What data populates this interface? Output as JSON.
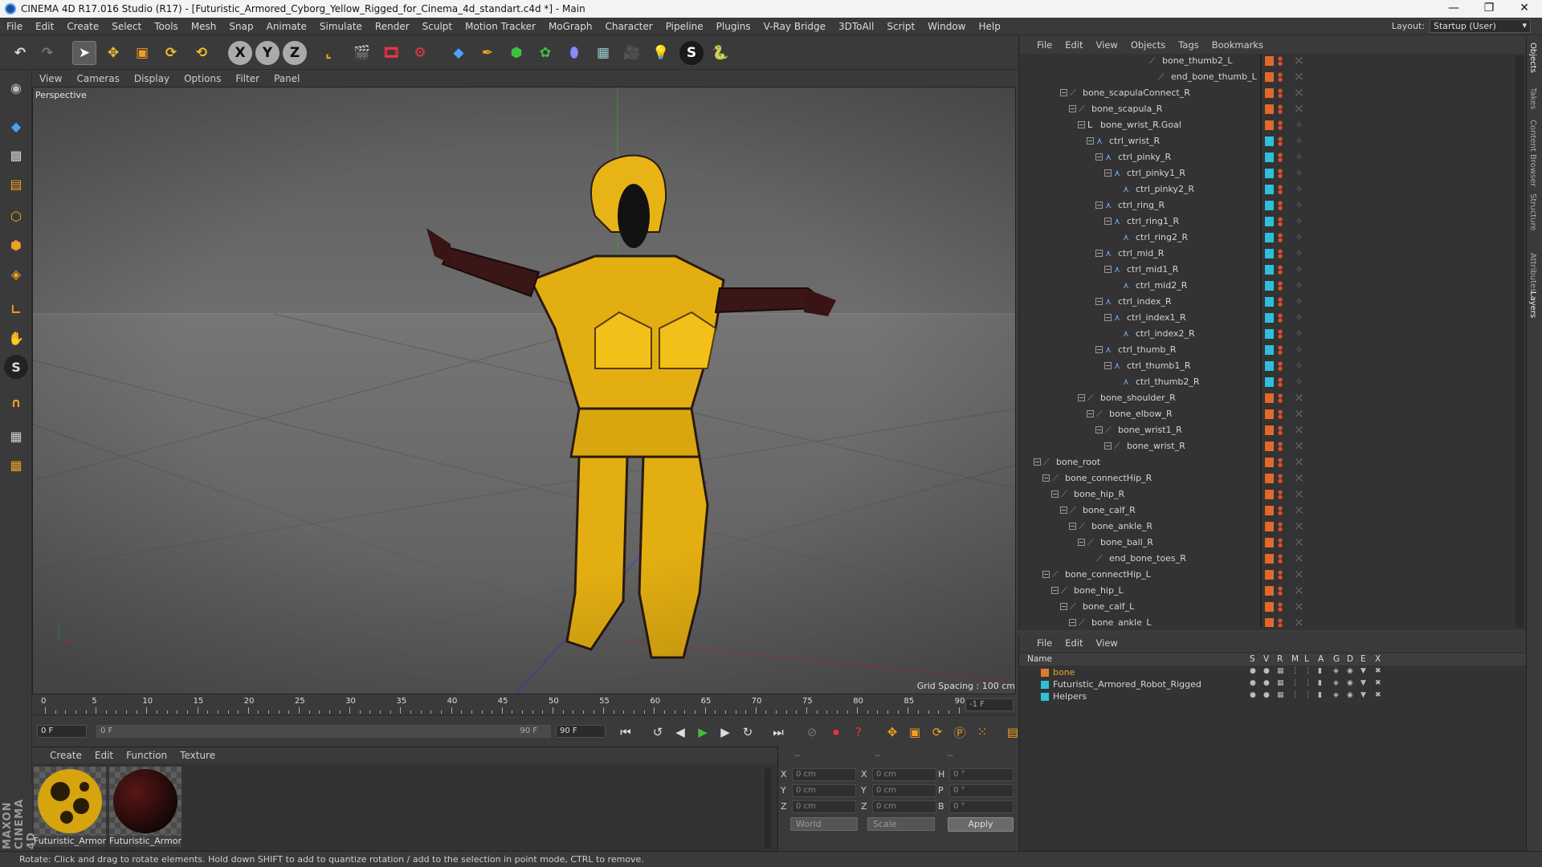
{
  "window": {
    "title": "CINEMA 4D R17.016 Studio (R17) - [Futuristic_Armored_Cyborg_Yellow_Rigged_for_Cinema_4d_standart.c4d *] - Main",
    "min": "—",
    "max": "❐",
    "close": "✕"
  },
  "menu": [
    "File",
    "Edit",
    "Create",
    "Select",
    "Tools",
    "Mesh",
    "Snap",
    "Animate",
    "Simulate",
    "Render",
    "Sculpt",
    "Motion Tracker",
    "MoGraph",
    "Character",
    "Pipeline",
    "Plugins",
    "V-Ray Bridge",
    "3DToAll",
    "Script",
    "Window",
    "Help"
  ],
  "layout": {
    "label": "Layout:",
    "value": "Startup (User)"
  },
  "toolbar": {
    "x": "X",
    "y": "Y",
    "z": "Z"
  },
  "viewport": {
    "menu": [
      "View",
      "Cameras",
      "Display",
      "Options",
      "Filter",
      "Panel"
    ],
    "label": "Perspective",
    "grid_spacing": "Grid Spacing : 100 cm"
  },
  "timeline": {
    "ticks": [
      "0",
      "5",
      "10",
      "15",
      "20",
      "25",
      "30",
      "35",
      "40",
      "45",
      "50",
      "55",
      "60",
      "65",
      "70",
      "75",
      "80",
      "85",
      "90"
    ],
    "end_field": "-1 F",
    "start_frame": "0 F",
    "range_start": "0 F",
    "range_end": "90 F",
    "end_frame": "90 F"
  },
  "materials": {
    "menu": [
      "Create",
      "Edit",
      "Function",
      "Texture"
    ],
    "items": [
      {
        "name": "Futuristic_Armor"
      },
      {
        "name": "Futuristic_Armor"
      }
    ]
  },
  "coords": {
    "hdr": [
      "--",
      "--",
      "--"
    ],
    "rows": [
      {
        "a": "X",
        "av": "0 cm",
        "b": "X",
        "bv": "0 cm",
        "c": "H",
        "cv": "0 °"
      },
      {
        "a": "Y",
        "av": "0 cm",
        "b": "Y",
        "bv": "0 cm",
        "c": "P",
        "cv": "0 °"
      },
      {
        "a": "Z",
        "av": "0 cm",
        "b": "Z",
        "bv": "0 cm",
        "c": "B",
        "cv": "0 °"
      }
    ],
    "world": "World",
    "scale": "Scale",
    "apply": "Apply"
  },
  "objects": {
    "menu": [
      "File",
      "Edit",
      "View",
      "Objects",
      "Tags",
      "Bookmarks"
    ],
    "rows": [
      {
        "label": "bone_thumb2_L",
        "depth": 14,
        "type": "bone",
        "color": "#e06a2a",
        "exp": ""
      },
      {
        "label": "end_bone_thumb_L",
        "depth": 15,
        "type": "bone",
        "color": "#e06a2a",
        "exp": ""
      },
      {
        "label": "bone_scapulaConnect_R",
        "depth": 5,
        "type": "bone",
        "color": "#e06a2a",
        "exp": "−"
      },
      {
        "label": "bone_scapula_R",
        "depth": 6,
        "type": "bone",
        "color": "#e06a2a",
        "exp": "−"
      },
      {
        "label": "bone_wrist_R.Goal",
        "depth": 7,
        "type": "null",
        "color": "#e06a2a",
        "exp": "−"
      },
      {
        "label": "ctrl_wrist_R",
        "depth": 8,
        "type": "ctrl",
        "color": "#2ec0d8",
        "exp": "−"
      },
      {
        "label": "ctrl_pinky_R",
        "depth": 9,
        "type": "ctrl",
        "color": "#2ec0d8",
        "exp": "−"
      },
      {
        "label": "ctrl_pinky1_R",
        "depth": 10,
        "type": "ctrl",
        "color": "#2ec0d8",
        "exp": "−"
      },
      {
        "label": "ctrl_pinky2_R",
        "depth": 11,
        "type": "ctrl",
        "color": "#2ec0d8",
        "exp": ""
      },
      {
        "label": "ctrl_ring_R",
        "depth": 9,
        "type": "ctrl",
        "color": "#2ec0d8",
        "exp": "−"
      },
      {
        "label": "ctrl_ring1_R",
        "depth": 10,
        "type": "ctrl",
        "color": "#2ec0d8",
        "exp": "−"
      },
      {
        "label": "ctrl_ring2_R",
        "depth": 11,
        "type": "ctrl",
        "color": "#2ec0d8",
        "exp": ""
      },
      {
        "label": "ctrl_mid_R",
        "depth": 9,
        "type": "ctrl",
        "color": "#2ec0d8",
        "exp": "−"
      },
      {
        "label": "ctrl_mid1_R",
        "depth": 10,
        "type": "ctrl",
        "color": "#2ec0d8",
        "exp": "−"
      },
      {
        "label": "ctrl_mid2_R",
        "depth": 11,
        "type": "ctrl",
        "color": "#2ec0d8",
        "exp": ""
      },
      {
        "label": "ctrl_index_R",
        "depth": 9,
        "type": "ctrl",
        "color": "#2ec0d8",
        "exp": "−"
      },
      {
        "label": "ctrl_index1_R",
        "depth": 10,
        "type": "ctrl",
        "color": "#2ec0d8",
        "exp": "−"
      },
      {
        "label": "ctrl_index2_R",
        "depth": 11,
        "type": "ctrl",
        "color": "#2ec0d8",
        "exp": ""
      },
      {
        "label": "ctrl_thumb_R",
        "depth": 9,
        "type": "ctrl",
        "color": "#2ec0d8",
        "exp": "−"
      },
      {
        "label": "ctrl_thumb1_R",
        "depth": 10,
        "type": "ctrl",
        "color": "#2ec0d8",
        "exp": "−"
      },
      {
        "label": "ctrl_thumb2_R",
        "depth": 11,
        "type": "ctrl",
        "color": "#2ec0d8",
        "exp": ""
      },
      {
        "label": "bone_shoulder_R",
        "depth": 7,
        "type": "bone",
        "color": "#e06a2a",
        "exp": "−"
      },
      {
        "label": "bone_elbow_R",
        "depth": 8,
        "type": "bone",
        "color": "#e06a2a",
        "exp": "−"
      },
      {
        "label": "bone_wrist1_R",
        "depth": 9,
        "type": "bone",
        "color": "#e06a2a",
        "exp": "−"
      },
      {
        "label": "bone_wrist_R",
        "depth": 10,
        "type": "bone",
        "color": "#e06a2a",
        "exp": "−"
      },
      {
        "label": "bone_root",
        "depth": 2,
        "type": "bone",
        "color": "#e06a2a",
        "exp": "−"
      },
      {
        "label": "bone_connectHip_R",
        "depth": 3,
        "type": "bone",
        "color": "#e06a2a",
        "exp": "−"
      },
      {
        "label": "bone_hip_R",
        "depth": 4,
        "type": "bone",
        "color": "#e06a2a",
        "exp": "−"
      },
      {
        "label": "bone_calf_R",
        "depth": 5,
        "type": "bone",
        "color": "#e06a2a",
        "exp": "−"
      },
      {
        "label": "bone_ankle_R",
        "depth": 6,
        "type": "bone",
        "color": "#e06a2a",
        "exp": "−"
      },
      {
        "label": "bone_ball_R",
        "depth": 7,
        "type": "bone",
        "color": "#e06a2a",
        "exp": "−"
      },
      {
        "label": "end_bone_toes_R",
        "depth": 8,
        "type": "bone",
        "color": "#e06a2a",
        "exp": ""
      },
      {
        "label": "bone_connectHip_L",
        "depth": 3,
        "type": "bone",
        "color": "#e06a2a",
        "exp": "−"
      },
      {
        "label": "bone_hip_L",
        "depth": 4,
        "type": "bone",
        "color": "#e06a2a",
        "exp": "−"
      },
      {
        "label": "bone_calf_L",
        "depth": 5,
        "type": "bone",
        "color": "#e06a2a",
        "exp": "−"
      },
      {
        "label": "bone_ankle_L",
        "depth": 6,
        "type": "bone",
        "color": "#e06a2a",
        "exp": "−"
      }
    ]
  },
  "layers": {
    "menu": [
      "File",
      "Edit",
      "View"
    ],
    "cols": [
      "Name",
      "S",
      "V",
      "R",
      "M",
      "L",
      "A",
      "G",
      "D",
      "E",
      "X"
    ],
    "rows": [
      {
        "name": "bone",
        "color": "#e07a2a",
        "text": "#f0a030"
      },
      {
        "name": "Futuristic_Armored_Robot_Rigged",
        "color": "#2ec0d8",
        "text": "#d4d4d4"
      },
      {
        "name": "Helpers",
        "color": "#2ec0d8",
        "text": "#d4d4d4"
      }
    ]
  },
  "dock_tabs": [
    "Objects",
    "Takes",
    "Content Browser",
    "Structure",
    "Attributes",
    "Layers"
  ],
  "brand": "MAXON CINEMA 4D",
  "status": "Rotate: Click and drag to rotate elements. Hold down SHIFT to add to quantize rotation / add to the selection in point mode, CTRL to remove."
}
